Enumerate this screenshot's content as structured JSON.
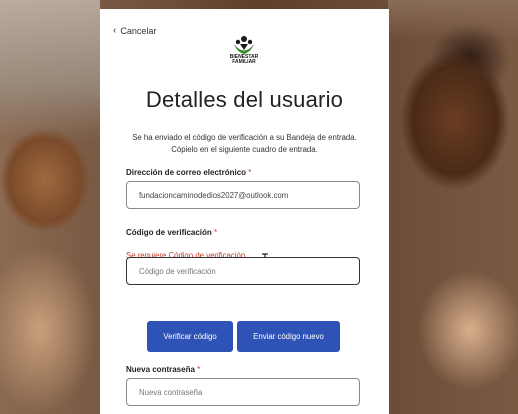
{
  "cancel_label": "Cancelar",
  "logo": {
    "line1": "BIENESTAR",
    "line2": "FAMILIAR"
  },
  "title": "Detalles del usuario",
  "intro": "Se ha enviado el código de verificación a su Bandeja de entrada. Cópielo en el siguiente cuadro de entrada.",
  "email": {
    "label": "Dirección de correo electrónico",
    "required": "*",
    "value": "fundacioncaminodedios2027@outlook.com"
  },
  "code": {
    "label": "Código de verificación",
    "required": "*",
    "error": "Se requiere Código de verificación.",
    "placeholder": "Código de verificación"
  },
  "buttons": {
    "verify": "Verificar código",
    "resend": "Enviar código nuevo"
  },
  "password": {
    "label": "Nueva contraseña",
    "required": "*",
    "placeholder": "Nueva contraseña"
  },
  "colors": {
    "primary_button": "#2f52b6",
    "error": "#c0392b"
  }
}
